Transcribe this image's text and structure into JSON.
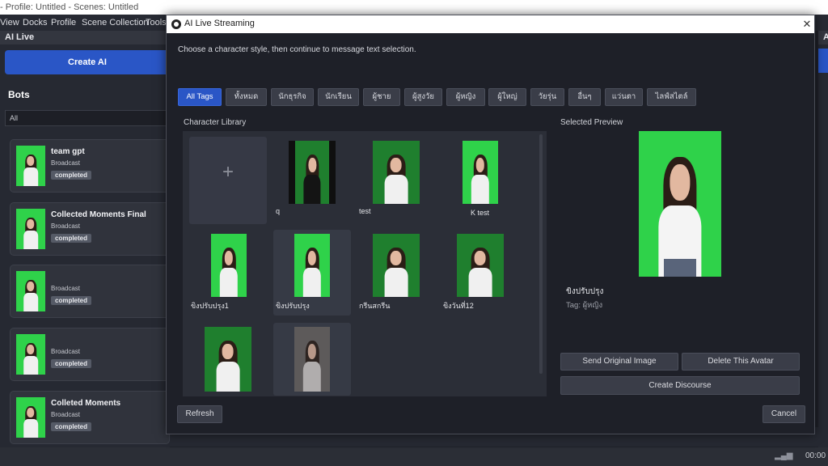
{
  "window": {
    "title": "- Profile: Untitled - Scenes: Untitled",
    "menu": [
      "View",
      "Docks",
      "Profile",
      "Scene Collection",
      "Tools"
    ]
  },
  "left_dock": {
    "header": "AI Live",
    "create_button": "Create AI",
    "bots_title": "Bots",
    "filter_value": "All",
    "bots": [
      {
        "name": "team gpt",
        "type": "Broadcast",
        "status": "completed"
      },
      {
        "name": "Collected Moments Final",
        "type": "Broadcast",
        "status": "completed"
      },
      {
        "name": "",
        "type": "Broadcast",
        "status": "completed"
      },
      {
        "name": "",
        "type": "Broadcast",
        "status": "completed"
      },
      {
        "name": "Colleted Moments",
        "type": "Broadcast",
        "status": "completed"
      }
    ]
  },
  "right_dock": {
    "header": "A"
  },
  "status_bar": {
    "time": "00:00"
  },
  "dialog": {
    "title": "AI Live Streaming",
    "close_glyph": "✕",
    "instruction": "Choose a character style, then continue to message text selection.",
    "tags": [
      "All Tags",
      "ทั้งหมด",
      "นักธุรกิจ",
      "นักเรียน",
      "ผู้ชาย",
      "ผู้สูงวัย",
      "ผู้หญิง",
      "ผู้ใหญ่",
      "วัยรุ่น",
      "อื่นๆ",
      "แว่นตา",
      "ไลฟ์สไตล์"
    ],
    "active_tag": "All Tags",
    "library_label": "Character Library",
    "add_glyph": "+",
    "characters": [
      {
        "name": "q",
        "style": "studio"
      },
      {
        "name": "test",
        "style": "dark"
      },
      {
        "name": "K test",
        "style": "green"
      },
      {
        "name": "ขิงปรับปรุง1",
        "style": "green"
      },
      {
        "name": "ขิงปรับปรุง",
        "style": "green"
      },
      {
        "name": "กรีนสกรีน",
        "style": "dark"
      },
      {
        "name": "ขิงวันที่12",
        "style": "dark"
      },
      {
        "name": "",
        "style": "dark"
      },
      {
        "name": "",
        "style": "faded"
      }
    ],
    "preview_label": "Selected Preview",
    "selected": {
      "name": "ขิงปรับปรุง",
      "tag_text": "Tag: ผู้หญิง"
    },
    "buttons": {
      "send_original": "Send Original Image",
      "delete_avatar": "Delete This Avatar",
      "create_discourse": "Create Discourse",
      "refresh": "Refresh",
      "cancel": "Cancel"
    }
  }
}
